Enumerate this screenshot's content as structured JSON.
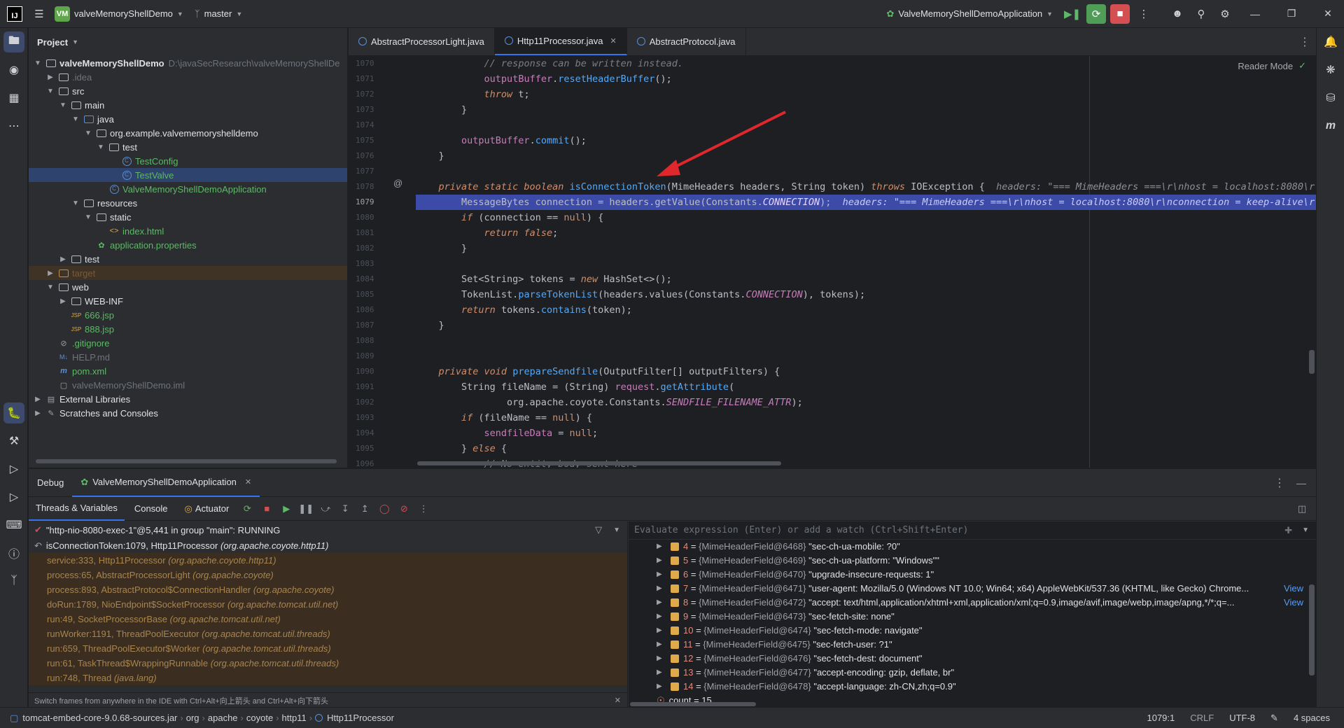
{
  "titlebar": {
    "project_badge": "VM",
    "project_name": "valveMemoryShellDemo",
    "branch": "master",
    "run_config": "ValveMemoryShellDemoApplication"
  },
  "project_panel": {
    "title": "Project",
    "tree": [
      {
        "indent": 0,
        "arrow": "v",
        "icon": "folder",
        "label": "valveMemoryShellDemo",
        "bold": true,
        "hint": "D:\\javaSecResearch\\valveMemoryShellDe"
      },
      {
        "indent": 1,
        "arrow": ">",
        "icon": "folder",
        "label": ".idea",
        "dim": true
      },
      {
        "indent": 1,
        "arrow": "v",
        "icon": "folder",
        "label": "src"
      },
      {
        "indent": 2,
        "arrow": "v",
        "icon": "folder",
        "label": "main"
      },
      {
        "indent": 3,
        "arrow": "v",
        "icon": "folder-blue",
        "label": "java"
      },
      {
        "indent": 4,
        "arrow": "v",
        "icon": "package",
        "label": "org.example.valvememoryshelldemo"
      },
      {
        "indent": 5,
        "arrow": "v",
        "icon": "package",
        "label": "test"
      },
      {
        "indent": 6,
        "arrow": "",
        "icon": "class",
        "label": "TestConfig",
        "green": true
      },
      {
        "indent": 6,
        "arrow": "",
        "icon": "class",
        "label": "TestValve",
        "green": true,
        "selected": true
      },
      {
        "indent": 5,
        "arrow": "",
        "icon": "class",
        "label": "ValveMemoryShellDemoApplication",
        "green": true
      },
      {
        "indent": 3,
        "arrow": "v",
        "icon": "folder",
        "label": "resources"
      },
      {
        "indent": 4,
        "arrow": "v",
        "icon": "folder",
        "label": "static"
      },
      {
        "indent": 5,
        "arrow": "",
        "icon": "html",
        "label": "index.html",
        "green": true
      },
      {
        "indent": 4,
        "arrow": "",
        "icon": "props",
        "label": "application.properties",
        "green": true
      },
      {
        "indent": 2,
        "arrow": ">",
        "icon": "folder",
        "label": "test"
      },
      {
        "indent": 1,
        "arrow": ">",
        "icon": "folder-orange",
        "label": "target",
        "dim": true,
        "orange": true
      },
      {
        "indent": 1,
        "arrow": "v",
        "icon": "folder",
        "label": "web"
      },
      {
        "indent": 2,
        "arrow": ">",
        "icon": "folder",
        "label": "WEB-INF"
      },
      {
        "indent": 2,
        "arrow": "",
        "icon": "jsp",
        "label": "666.jsp",
        "green": true
      },
      {
        "indent": 2,
        "arrow": "",
        "icon": "jsp",
        "label": "888.jsp",
        "green": true
      },
      {
        "indent": 1,
        "arrow": "",
        "icon": "gitignore",
        "label": ".gitignore",
        "green": true
      },
      {
        "indent": 1,
        "arrow": "",
        "icon": "md",
        "label": "HELP.md",
        "dim": true
      },
      {
        "indent": 1,
        "arrow": "",
        "icon": "maven",
        "label": "pom.xml",
        "green": true
      },
      {
        "indent": 1,
        "arrow": "",
        "icon": "iml",
        "label": "valveMemoryShellDemo.iml",
        "dim": true
      },
      {
        "indent": 0,
        "arrow": ">",
        "icon": "lib",
        "label": "External Libraries"
      },
      {
        "indent": 0,
        "arrow": ">",
        "icon": "scratch",
        "label": "Scratches and Consoles"
      }
    ]
  },
  "editor": {
    "tabs": [
      {
        "label": "AbstractProcessorLight.java",
        "active": false
      },
      {
        "label": "Http11Processor.java",
        "active": true
      },
      {
        "label": "AbstractProtocol.java",
        "active": false
      }
    ],
    "reader_mode": "Reader Mode",
    "line_numbers": [
      "1070",
      "1071",
      "1072",
      "1073",
      "1074",
      "1075",
      "1076",
      "1077",
      "1078",
      "1079",
      "1080",
      "1081",
      "1082",
      "1083",
      "1084",
      "1085",
      "1086",
      "1087",
      "1088",
      "1089",
      "1090",
      "1091",
      "1092",
      "1093",
      "1094",
      "1095",
      "1096"
    ],
    "current_line": "1079"
  },
  "debug": {
    "title": "Debug",
    "session": "ValveMemoryShellDemoApplication",
    "subtabs": [
      "Threads & Variables",
      "Console",
      "Actuator"
    ],
    "thread": "\"http-nio-8080-exec-1\"@5,441 in group \"main\": RUNNING",
    "frames": [
      {
        "method": "isConnectionToken:1079, Http11Processor",
        "loc": "(org.apache.coyote.http11)",
        "selected": true
      },
      {
        "method": "service:333, Http11Processor",
        "loc": "(org.apache.coyote.http11)"
      },
      {
        "method": "process:65, AbstractProcessorLight",
        "loc": "(org.apache.coyote)"
      },
      {
        "method": "process:893, AbstractProtocol$ConnectionHandler",
        "loc": "(org.apache.coyote)"
      },
      {
        "method": "doRun:1789, NioEndpoint$SocketProcessor",
        "loc": "(org.apache.tomcat.util.net)"
      },
      {
        "method": "run:49, SocketProcessorBase",
        "loc": "(org.apache.tomcat.util.net)"
      },
      {
        "method": "runWorker:1191, ThreadPoolExecutor",
        "loc": "(org.apache.tomcat.util.threads)"
      },
      {
        "method": "run:659, ThreadPoolExecutor$Worker",
        "loc": "(org.apache.tomcat.util.threads)"
      },
      {
        "method": "run:61, TaskThread$WrappingRunnable",
        "loc": "(org.apache.tomcat.util.threads)"
      },
      {
        "method": "run:748, Thread",
        "loc": "(java.lang)"
      }
    ],
    "switch_hint": "Switch frames from anywhere in the IDE with Ctrl+Alt+向上箭头 and Ctrl+Alt+向下箭头",
    "eval_placeholder": "Evaluate expression (Enter) or add a watch (Ctrl+Shift+Enter)",
    "vars": [
      {
        "idx": "4",
        "ref": "{MimeHeaderField@6468}",
        "val": "\"sec-ch-ua-mobile: ?0\""
      },
      {
        "idx": "5",
        "ref": "{MimeHeaderField@6469}",
        "val": "\"sec-ch-ua-platform: \"Windows\"\""
      },
      {
        "idx": "6",
        "ref": "{MimeHeaderField@6470}",
        "val": "\"upgrade-insecure-requests: 1\""
      },
      {
        "idx": "7",
        "ref": "{MimeHeaderField@6471}",
        "val": "\"user-agent: Mozilla/5.0 (Windows NT 10.0; Win64; x64) AppleWebKit/537.36 (KHTML, like Gecko) Chrome...",
        "view": "View"
      },
      {
        "idx": "8",
        "ref": "{MimeHeaderField@6472}",
        "val": "\"accept: text/html,application/xhtml+xml,application/xml;q=0.9,image/avif,image/webp,image/apng,*/*;q=...",
        "view": "View"
      },
      {
        "idx": "9",
        "ref": "{MimeHeaderField@6473}",
        "val": "\"sec-fetch-site: none\""
      },
      {
        "idx": "10",
        "ref": "{MimeHeaderField@6474}",
        "val": "\"sec-fetch-mode: navigate\""
      },
      {
        "idx": "11",
        "ref": "{MimeHeaderField@6475}",
        "val": "\"sec-fetch-user: ?1\""
      },
      {
        "idx": "12",
        "ref": "{MimeHeaderField@6476}",
        "val": "\"sec-fetch-dest: document\""
      },
      {
        "idx": "13",
        "ref": "{MimeHeaderField@6477}",
        "val": "\"accept-encoding: gzip, deflate, br\""
      },
      {
        "idx": "14",
        "ref": "{MimeHeaderField@6478}",
        "val": "\"accept-language: zh-CN,zh;q=0.9\""
      }
    ],
    "count": "count = 15"
  },
  "statusbar": {
    "crumbs": [
      "tomcat-embed-core-9.0.68-sources.jar",
      "org",
      "apache",
      "coyote",
      "http11",
      "Http11Processor"
    ],
    "position": "1079:1",
    "line_sep": "CRLF",
    "encoding": "UTF-8",
    "indent": "4 spaces"
  },
  "colors": {
    "accent": "#3574f0",
    "highlight": "#3c4ba8",
    "arrow": "#e0282c"
  }
}
